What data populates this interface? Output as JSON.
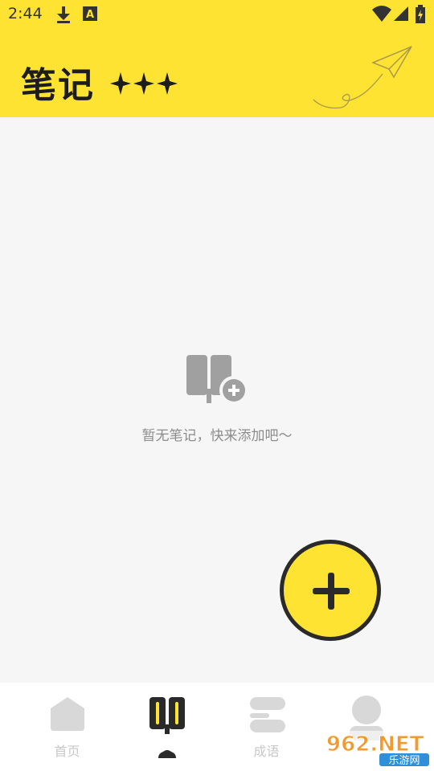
{
  "status_bar": {
    "time": "2:44",
    "icons": [
      "download-icon",
      "a-badge-icon",
      "wifi-icon",
      "signal-icon",
      "battery-icon"
    ]
  },
  "header": {
    "title": "笔记",
    "decoration": "paper-plane-icon",
    "stars": "✦✦✦",
    "background_color": "#fee333"
  },
  "empty_state": {
    "icon": "note-add-icon",
    "message": "暂无笔记，快来添加吧～"
  },
  "fab": {
    "icon": "plus-icon",
    "color": "#fee333"
  },
  "bottom_nav": {
    "items": [
      {
        "label": "首页",
        "icon": "home-icon",
        "active": false
      },
      {
        "label": "",
        "icon": "notes-icon",
        "active": true
      },
      {
        "label": "成语",
        "icon": "idiom-icon",
        "active": false
      },
      {
        "label": "",
        "icon": "profile-icon",
        "active": false
      }
    ]
  },
  "watermark": {
    "brand": "962.NET",
    "sub": "乐游网"
  }
}
